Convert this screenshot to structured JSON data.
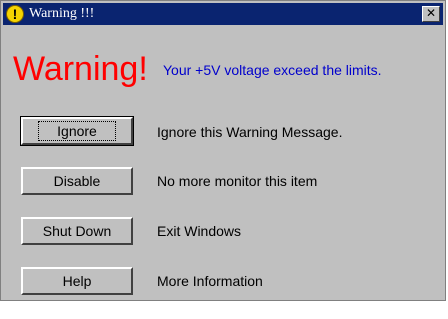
{
  "window": {
    "title": "Warning !!!",
    "title_icon": "!",
    "close_label": "✕"
  },
  "headline": {
    "title": "Warning!",
    "message": "Your +5V voltage exceed the limits."
  },
  "actions": [
    {
      "button": "Ignore",
      "description": "Ignore this Warning Message."
    },
    {
      "button": "Disable",
      "description": "No more monitor this item"
    },
    {
      "button": "Shut Down",
      "description": "Exit Windows"
    },
    {
      "button": "Help",
      "description": "More Information"
    }
  ],
  "colors": {
    "titlebar": "#0a2470",
    "dialog_bg": "#c0c0c0",
    "headline": "#ff0000",
    "message": "#0000cc"
  },
  "icons": {
    "title": "exclamation-icon",
    "close": "close-icon"
  }
}
